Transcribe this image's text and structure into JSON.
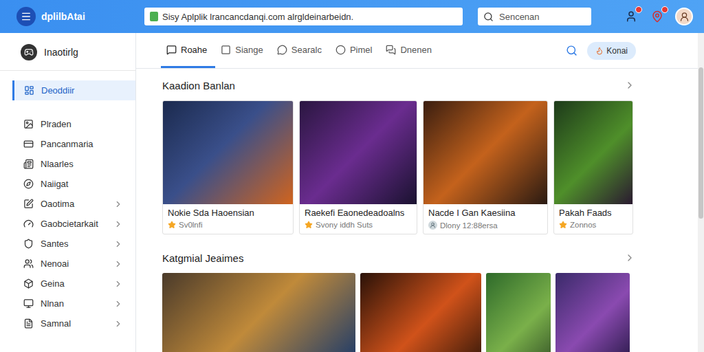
{
  "app": {
    "title": "dplilbAtai"
  },
  "address_bar": {
    "value": "Sisy Aplplik lrancancdanqi.com alrgldeinarbeidn."
  },
  "search": {
    "placeholder": "Sencenan"
  },
  "sidebar": {
    "header": "Inaotirlg",
    "items": [
      {
        "label": "Deoddiir",
        "selected": true,
        "expandable": false
      },
      {
        "label": "Plraden",
        "selected": false,
        "expandable": false
      },
      {
        "label": "Pancanmaria",
        "selected": false,
        "expandable": false
      },
      {
        "label": "Nlaarles",
        "selected": false,
        "expandable": false
      },
      {
        "label": "Naiigat",
        "selected": false,
        "expandable": false
      },
      {
        "label": "Oaotima",
        "selected": false,
        "expandable": true
      },
      {
        "label": "Gaobcietarkait",
        "selected": false,
        "expandable": true
      },
      {
        "label": "Santes",
        "selected": false,
        "expandable": true
      },
      {
        "label": "Nenoai",
        "selected": false,
        "expandable": true
      },
      {
        "label": "Geina",
        "selected": false,
        "expandable": true
      },
      {
        "label": "Nlnan",
        "selected": false,
        "expandable": true
      },
      {
        "label": "Samnal",
        "selected": false,
        "expandable": true
      }
    ]
  },
  "tabs": [
    {
      "label": "Roahe",
      "selected": true
    },
    {
      "label": "Siange",
      "selected": false
    },
    {
      "label": "Searalc",
      "selected": false
    },
    {
      "label": "Pimel",
      "selected": false
    },
    {
      "label": "Dnenen",
      "selected": false
    }
  ],
  "action_button": {
    "label": "Konai"
  },
  "featured": {
    "title": "Kaadion Banlan",
    "cards": [
      {
        "title": "Nokie Sda Haoensian",
        "meta": "Sv0lnfi",
        "kind": "rating"
      },
      {
        "title": "Raekefi Eaonedeadoalns",
        "meta": "Svony iddh Suts",
        "kind": "rating"
      },
      {
        "title": "Nacde I Gan Kaesiina",
        "meta": "Dlony 12:88ersa",
        "kind": "player"
      },
      {
        "title": "Pakah Faads",
        "meta": "Zonnos",
        "kind": "rating"
      }
    ]
  },
  "categories": {
    "title": "Katgmial Jeaimes"
  }
}
